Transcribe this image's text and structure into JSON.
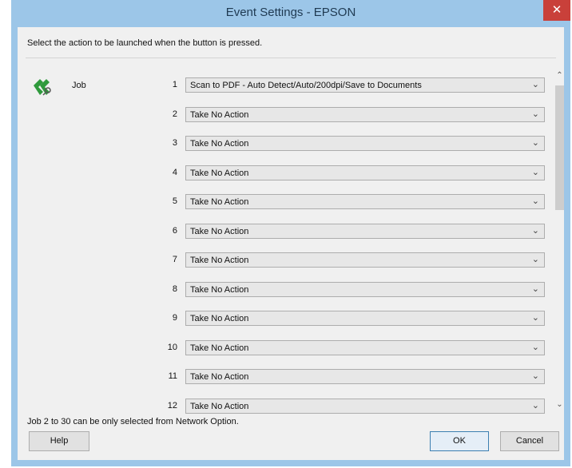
{
  "window": {
    "title": "Event Settings - EPSON",
    "close_glyph": "✕"
  },
  "instruction": "Select the action to be launched when the button is pressed.",
  "job": {
    "label": "Job",
    "icon": "scanner-job-icon"
  },
  "rows": [
    {
      "num": "1",
      "value": "Scan to PDF - Auto Detect/Auto/200dpi/Save to Documents"
    },
    {
      "num": "2",
      "value": "Take No Action"
    },
    {
      "num": "3",
      "value": "Take No Action"
    },
    {
      "num": "4",
      "value": "Take No Action"
    },
    {
      "num": "5",
      "value": "Take No Action"
    },
    {
      "num": "6",
      "value": "Take No Action"
    },
    {
      "num": "7",
      "value": "Take No Action"
    },
    {
      "num": "8",
      "value": "Take No Action"
    },
    {
      "num": "9",
      "value": "Take No Action"
    },
    {
      "num": "10",
      "value": "Take No Action"
    },
    {
      "num": "11",
      "value": "Take No Action"
    },
    {
      "num": "12",
      "value": "Take No Action"
    }
  ],
  "note": "Job 2 to 30 can be only selected from Network Option.",
  "buttons": {
    "help": "Help",
    "ok": "OK",
    "cancel": "Cancel"
  },
  "colors": {
    "title_bar": "#9cc6e8",
    "close_button": "#c9403a",
    "dialog_bg": "#f0f0f0",
    "icon_green": "#2f9a3c"
  }
}
